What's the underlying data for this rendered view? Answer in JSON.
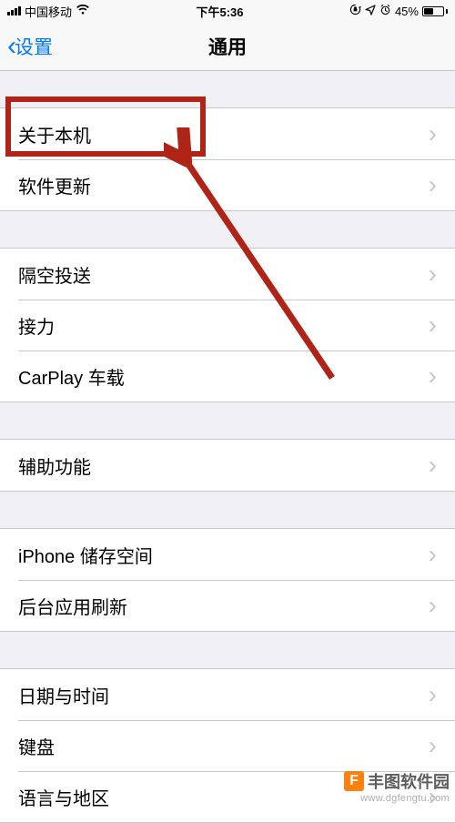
{
  "status": {
    "carrier": "中国移动",
    "time": "下午5:36",
    "battery_pct": "45%"
  },
  "nav": {
    "back_label": "设置",
    "title": "通用"
  },
  "groups": [
    {
      "rows": [
        {
          "label": "关于本机"
        },
        {
          "label": "软件更新"
        }
      ]
    },
    {
      "rows": [
        {
          "label": "隔空投送"
        },
        {
          "label": "接力"
        },
        {
          "label": "CarPlay 车载"
        }
      ]
    },
    {
      "rows": [
        {
          "label": "辅助功能"
        }
      ]
    },
    {
      "rows": [
        {
          "label": "iPhone 储存空间"
        },
        {
          "label": "后台应用刷新"
        }
      ]
    },
    {
      "rows": [
        {
          "label": "日期与时间"
        },
        {
          "label": "键盘"
        },
        {
          "label": "语言与地区"
        }
      ]
    }
  ],
  "watermark": {
    "name": "丰图软件园",
    "url": "www.dgfengtu.com"
  }
}
